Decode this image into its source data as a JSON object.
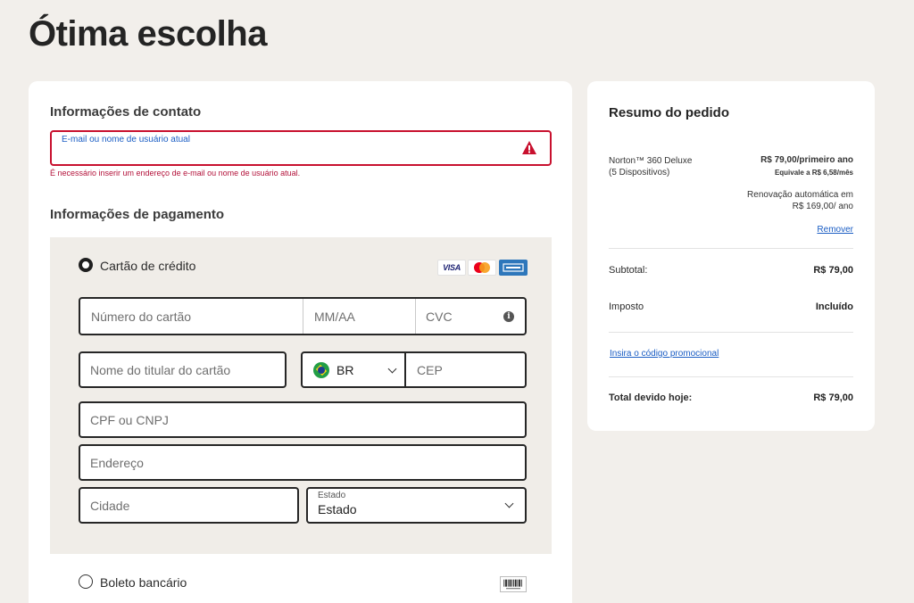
{
  "page": {
    "title": "Ótima escolha"
  },
  "contact": {
    "section_title": "Informações de contato",
    "email_label": "E-mail ou nome de usuário atual",
    "email_value": "",
    "email_error": "É necessário inserir um endereço de e-mail ou nome de usuário atual."
  },
  "payment": {
    "section_title": "Informações de pagamento",
    "credit_card": {
      "label": "Cartão de crédito",
      "selected": true,
      "logos": [
        "visa",
        "mastercard",
        "amex"
      ],
      "visa_text": "VISA",
      "card_number_placeholder": "Número do cartão",
      "expiry_placeholder": "MM/AA",
      "cvc_placeholder": "CVC",
      "holder_placeholder": "Nome do titular do cartão",
      "country_code": "BR",
      "zip_placeholder": "CEP",
      "tax_id_placeholder": "CPF ou CNPJ",
      "address_placeholder": "Endereço",
      "city_placeholder": "Cidade",
      "state_label": "Estado",
      "state_value": "Estado"
    },
    "boleto": {
      "label": "Boleto bancário",
      "selected": false
    }
  },
  "summary": {
    "title": "Resumo do pedido",
    "product_name": "Norton™ 360 Deluxe",
    "product_devices": "(5 Dispositivos)",
    "price": "R$ 79,00/primeiro ano",
    "price_monthly": "Equivale a R$ 6,58/mês",
    "renewal_line1": "Renovação automática em",
    "renewal_line2": "R$ 169,00/ ano",
    "remove_link": "Remover",
    "subtotal_label": "Subtotal:",
    "subtotal_value": "R$ 79,00",
    "tax_label": "Imposto",
    "tax_value": "Incluído",
    "promo_link": "Insira o código promocional",
    "total_label": "Total devido hoje:",
    "total_value": "R$ 79,00"
  },
  "colors": {
    "error": "#c8102e",
    "link": "#1a5dc4",
    "background": "#f2efeb",
    "panel": "#f0ede8"
  },
  "icons": [
    "warning-icon",
    "info-icon",
    "chevron-down-icon",
    "brazil-flag-icon",
    "visa-logo",
    "mastercard-logo",
    "amex-logo",
    "boleto-barcode-icon"
  ]
}
